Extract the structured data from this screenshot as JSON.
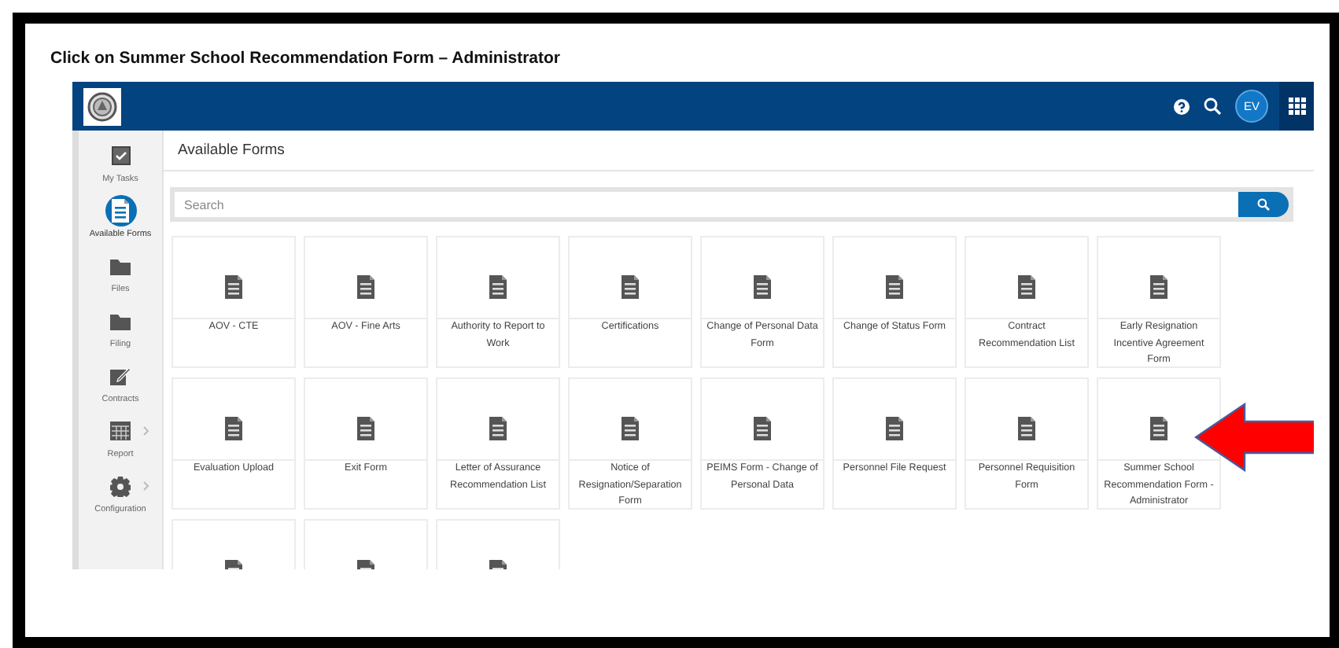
{
  "instruction": "Click on Summer School Recommendation Form – Administrator",
  "header": {
    "avatar": "EV"
  },
  "sidebar": {
    "items": [
      {
        "label": "My Tasks",
        "kind": "tasks",
        "selected": false,
        "has_submenu": false
      },
      {
        "label": "Available Forms",
        "kind": "forms",
        "selected": true,
        "has_submenu": false
      },
      {
        "label": "Files",
        "kind": "folder",
        "selected": false,
        "has_submenu": false
      },
      {
        "label": "Filing",
        "kind": "folder",
        "selected": false,
        "has_submenu": false
      },
      {
        "label": "Contracts",
        "kind": "edit",
        "selected": false,
        "has_submenu": false
      },
      {
        "label": "Report",
        "kind": "report",
        "selected": false,
        "has_submenu": true
      },
      {
        "label": "Configuration",
        "kind": "settings",
        "selected": false,
        "has_submenu": true
      }
    ]
  },
  "page_title": "Available Forms",
  "search": {
    "placeholder": "Search"
  },
  "forms": [
    {
      "kind": "full",
      "label": "AOV - CTE",
      "pointed": false
    },
    {
      "kind": "full",
      "label": "AOV - Fine Arts",
      "pointed": false
    },
    {
      "kind": "full",
      "label": "Authority to Report to Work",
      "pointed": false
    },
    {
      "kind": "full",
      "label": "Certifications",
      "pointed": false
    },
    {
      "kind": "full",
      "label": "Change of Personal Data Form",
      "pointed": false
    },
    {
      "kind": "full",
      "label": "Change of Status Form",
      "pointed": false
    },
    {
      "kind": "full",
      "label": "Contract Recommendation List",
      "pointed": false
    },
    {
      "kind": "full",
      "label": "Early Resignation Incentive Agreement Form",
      "pointed": false
    },
    {
      "kind": "full",
      "label": "Evaluation Upload",
      "pointed": false
    },
    {
      "kind": "full",
      "label": "Exit Form",
      "pointed": false
    },
    {
      "kind": "full",
      "label": "Letter of Assurance Recommendation List",
      "pointed": false
    },
    {
      "kind": "full",
      "label": "Notice of Resignation/Separation Form",
      "pointed": false
    },
    {
      "kind": "full",
      "label": "PEIMS Form - Change of Personal Data",
      "pointed": false
    },
    {
      "kind": "full",
      "label": "Personnel File Request",
      "pointed": false
    },
    {
      "kind": "full",
      "label": "Personnel Requisition Form",
      "pointed": false
    },
    {
      "kind": "full",
      "label": "Summer School Recommendation Form - Administrator",
      "pointed": true
    },
    {
      "kind": "cut",
      "pointed": false
    },
    {
      "kind": "cut",
      "pointed": false
    },
    {
      "kind": "cut",
      "pointed": false
    }
  ]
}
